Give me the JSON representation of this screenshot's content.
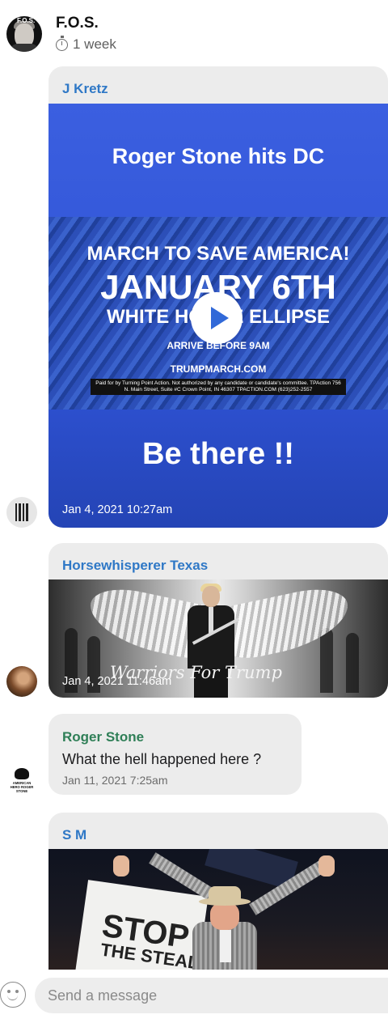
{
  "header": {
    "avatar_text": "F.O.S.",
    "group_name": "F.O.S.",
    "timer_label": "1 week"
  },
  "messages": [
    {
      "sender": "J Kretz",
      "poster": {
        "title_top": "Roger Stone hits DC",
        "line1": "MARCH TO SAVE AMERICA!",
        "line2": "JANUARY 6TH",
        "line3": "WHITE HOUSE ELLIPSE",
        "line4": "ARRIVE BEFORE 9AM",
        "line5": "TRUMPMARCH.COM",
        "fine_print": "Paid for by Turning Point Action. Not authorized by any candidate or candidate's committee. TPAction 756 N. Main Street, Suite #C Crown Point, IN 46307 TPACTION.COM (623)252-2557",
        "title_bottom": "Be there !!"
      },
      "timestamp": "Jan 4, 2021 10:27am"
    },
    {
      "sender": "Horsewhisperer Texas",
      "image_caption": "Warriors For Trump",
      "timestamp": "Jan 4, 2021 11:46am"
    },
    {
      "sender": "Roger Stone",
      "text": "What the hell happened here ?",
      "timestamp": "Jan 11, 2021 7:25am",
      "avatar_text": "AMERICAN HERO ROGER STONE"
    },
    {
      "sender": "S M",
      "image_text_1": "STOP",
      "image_text_2": "THE STEAL"
    }
  ],
  "composer": {
    "placeholder": "Send a message"
  },
  "colors": {
    "sender_blue": "#2f78c6",
    "sender_green": "#2f7f57",
    "bubble_bg": "#ececec",
    "poster_blue": "#3357d8"
  },
  "icons": {
    "timer": "timer-icon",
    "play": "play-icon",
    "emoji": "emoji-icon"
  }
}
